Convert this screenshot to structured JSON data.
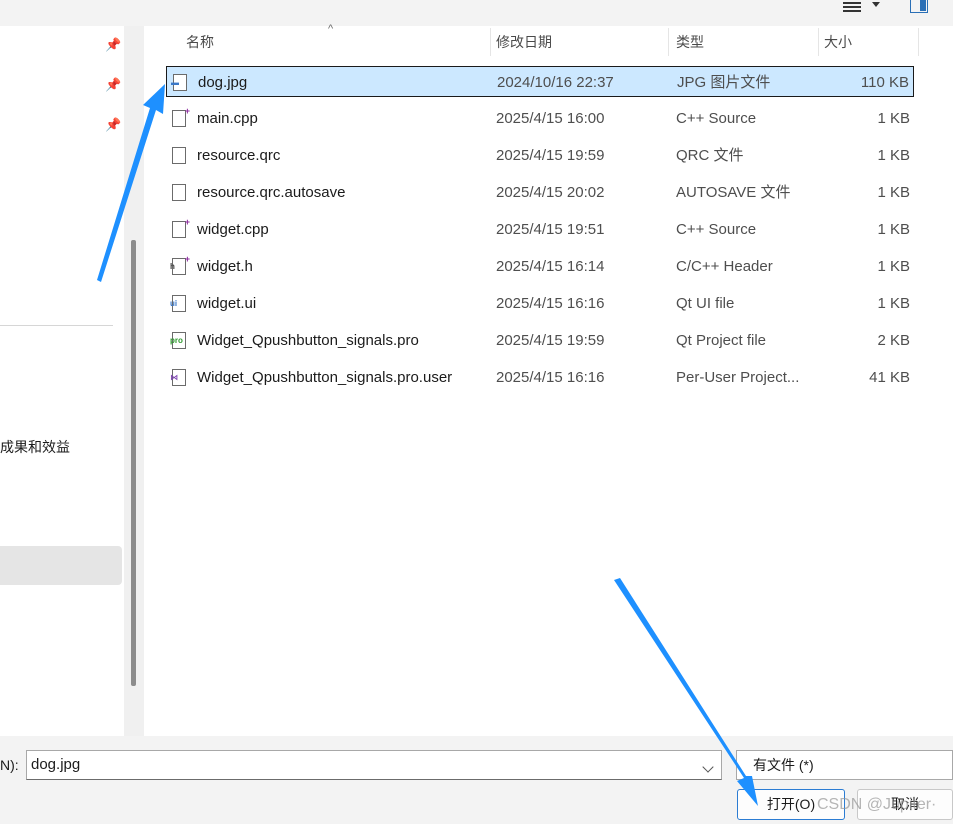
{
  "columns": {
    "name": "名称",
    "date": "修改日期",
    "type": "类型",
    "size": "大小"
  },
  "files": [
    {
      "name": "dog.jpg",
      "date": "2024/10/16 22:37",
      "type": "JPG 图片文件",
      "size": "110 KB",
      "icon": "image-file-icon",
      "selected": true
    },
    {
      "name": "main.cpp",
      "date": "2025/4/15 16:00",
      "type": "C++ Source",
      "size": "1 KB",
      "icon": "cpp-file-icon"
    },
    {
      "name": "resource.qrc",
      "date": "2025/4/15 19:59",
      "type": "QRC 文件",
      "size": "1 KB",
      "icon": "blank-file-icon"
    },
    {
      "name": "resource.qrc.autosave",
      "date": "2025/4/15 20:02",
      "type": "AUTOSAVE 文件",
      "size": "1 KB",
      "icon": "blank-file-icon"
    },
    {
      "name": "widget.cpp",
      "date": "2025/4/15 19:51",
      "type": "C++ Source",
      "size": "1 KB",
      "icon": "cpp-file-icon"
    },
    {
      "name": "widget.h",
      "date": "2025/4/15 16:14",
      "type": "C/C++ Header",
      "size": "1 KB",
      "icon": "header-file-icon"
    },
    {
      "name": "widget.ui",
      "date": "2025/4/15 16:16",
      "type": "Qt UI file",
      "size": "1 KB",
      "icon": "qt-ui-file-icon"
    },
    {
      "name": "Widget_Qpushbutton_signals.pro",
      "date": "2025/4/15 19:59",
      "type": "Qt Project file",
      "size": "2 KB",
      "icon": "qt-pro-file-icon"
    },
    {
      "name": "Widget_Qpushbutton_signals.pro.user",
      "date": "2025/4/15 16:16",
      "type": "Per-User Project...",
      "size": "41 KB",
      "icon": "vs-user-file-icon"
    }
  ],
  "nav": {
    "partial_item": "成果和效益"
  },
  "bottom": {
    "filename_label": "N):",
    "filename_value": "dog.jpg",
    "filter_value": "有文件 (*)",
    "open_label": "打开(O)",
    "cancel_label": "取消"
  },
  "watermark": "CSDN @Jupiter·",
  "colors": {
    "selection": "#cce8ff",
    "arrow": "#1e90ff",
    "accent": "#2b7cd3"
  }
}
